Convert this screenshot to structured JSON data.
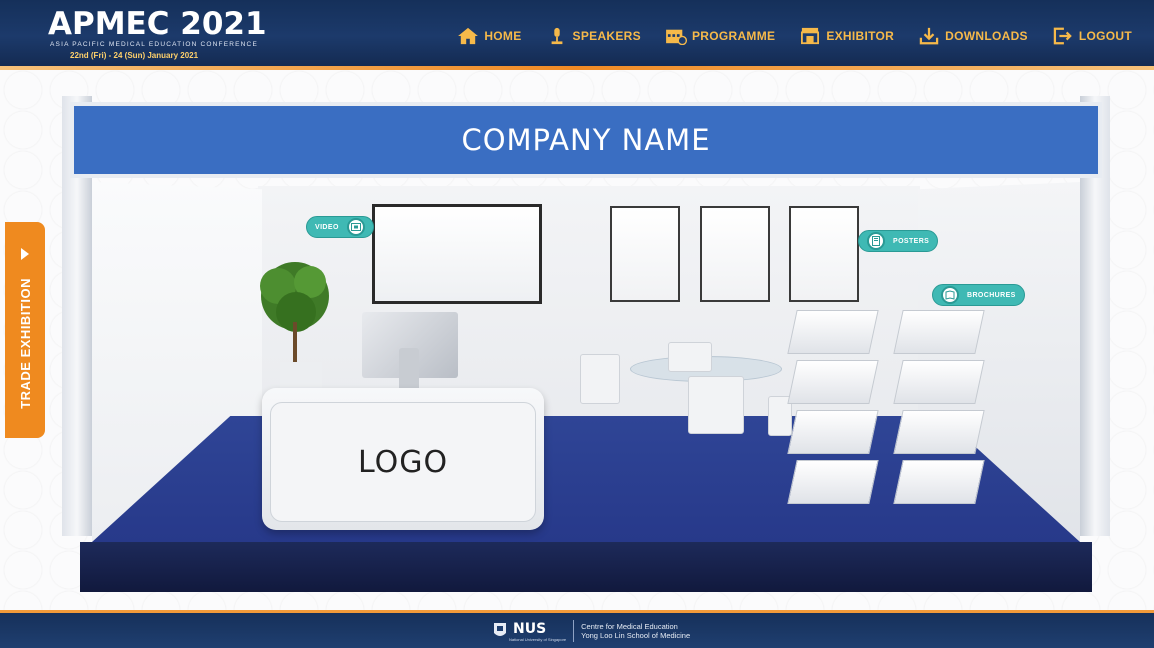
{
  "brand": {
    "title": "APMEC 2021",
    "subtitle": "ASIA PACIFIC MEDICAL EDUCATION CONFERENCE",
    "dates": "22nd (Fri) - 24 (Sun) January 2021"
  },
  "nav": {
    "items": [
      {
        "label": "HOME",
        "icon": "home-icon"
      },
      {
        "label": "SPEAKERS",
        "icon": "microphone-icon"
      },
      {
        "label": "PROGRAMME",
        "icon": "calendar-icon"
      },
      {
        "label": "EXHIBITOR",
        "icon": "booth-icon"
      },
      {
        "label": "DOWNLOADS",
        "icon": "download-icon"
      },
      {
        "label": "LOGOUT",
        "icon": "logout-icon"
      }
    ]
  },
  "sidebar_tab": {
    "label": "TRADE EXHIBITION",
    "icon": "arrow-right-icon"
  },
  "booth": {
    "company_name": "COMPANY NAME",
    "logo_text": "LOGO",
    "hotspots": {
      "video": "VIDEO",
      "posters": "POSTERS",
      "brochures": "BROCHURES"
    }
  },
  "footer": {
    "org": "NUS",
    "org_sub": "National University of Singapore",
    "line1": "Centre for Medical Education",
    "line2": "Yong Loo Lin School of Medicine"
  },
  "colors": {
    "header_bg": "#1c3a6b",
    "nav_text": "#f6b94a",
    "accent_orange": "#ef8a1f",
    "fascia_blue": "#3a6ec2",
    "floor_blue": "#2f4596",
    "hotspot_teal": "#3fb9b4"
  }
}
